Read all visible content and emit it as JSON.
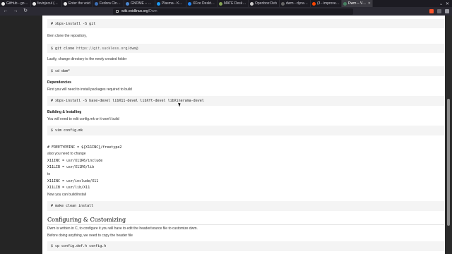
{
  "tabs": [
    {
      "label": "GitHub - gokcel",
      "color": "#e8e8e8"
    },
    {
      "label": "fevinjecul (Kev",
      "color": "#e8e8e8"
    },
    {
      "label": "Enter the void",
      "color": "#e8e8e8"
    },
    {
      "label": "Fedora Cinnam",
      "color": "#3c6eb4"
    },
    {
      "label": "GNOME – Simp",
      "color": "#4a86cf"
    },
    {
      "label": "Plasma - KDE C",
      "color": "#1d99f3"
    },
    {
      "label": "XFce Desktop E",
      "color": "#2284f2"
    },
    {
      "label": "MATE Desktop",
      "color": "#87a556"
    },
    {
      "label": "Openbox:Deb",
      "color": "#cccccc"
    },
    {
      "label": "dwm - dynamic",
      "color": "#666666"
    },
    {
      "label": "(3 - improved t",
      "color": "#ff4500"
    },
    {
      "label": "Dwm – Void",
      "color": "#478061",
      "active": true
    }
  ],
  "url": {
    "domain": "wiki.voidlinux.org",
    "path": "/Dwm"
  },
  "content": {
    "code_1": "# xbps-install -S git",
    "text_1": "then clone the repository,",
    "code_2_cmd": "$ git clone ",
    "code_2_link": "https://git.suckless.org/dwm@",
    "text_2": "Lastly, change directory to the newly created folder",
    "code_3": "$ cd dwm*",
    "heading_deps": "Dependencies",
    "text_3": "First you will need to install packages required to build",
    "code_4": "# xbps-install -S base-devel libX11-devel libXft-devel libXinerama-devel",
    "heading_build": "Building & Installing",
    "text_4": "You will need to edit config.mk or it won't build",
    "code_5": "$ vim config.mk",
    "line_freetype": "# FREETYPEINC = ${X11INC}/freetype2",
    "text_5": "also you need to change",
    "line_x11inc_1": "X11INC = usr/X11R6/include",
    "line_x11lib_1": "X11LIB = usr/X11R6/lib",
    "text_to": "to",
    "line_x11inc_2": "X11INC = usr/include/X11",
    "line_x11lib_2": "X11LIB = usr/lib/X11",
    "text_6": "Now you can build/install",
    "code_6": "# make clean install",
    "heading_config": "Configuring & Customizing",
    "text_7": "Dwm is written in C, to configure it you will have to edit the header/source file to customize dwm.",
    "text_8": "Before doing anything, we need to copy the header file",
    "code_7": "$ cp config.def.h config.h"
  }
}
